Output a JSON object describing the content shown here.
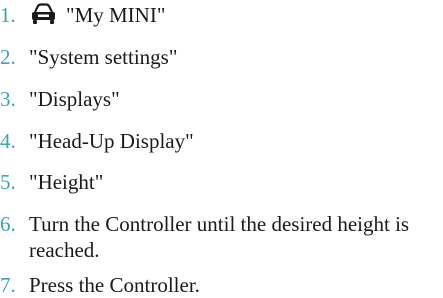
{
  "steps": [
    {
      "number": "1.",
      "text": "\"My MINI\"",
      "icon": "car-icon"
    },
    {
      "number": "2.",
      "text": "\"System settings\""
    },
    {
      "number": "3.",
      "text": "\"Displays\""
    },
    {
      "number": "4.",
      "text": "\"Head-Up Display\""
    },
    {
      "number": "5.",
      "text": "\"Height\""
    },
    {
      "number": "6.",
      "text": "Turn the Controller until the desired height is reached."
    },
    {
      "number": "7.",
      "text": "Press the Controller."
    }
  ],
  "colors": {
    "number": "#3aa3b8",
    "text": "#1a1a1a",
    "background": "#ffffff"
  }
}
